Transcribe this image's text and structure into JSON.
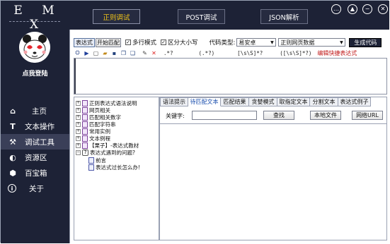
{
  "brand": "E M X",
  "login": "点我登陆",
  "nav": [
    {
      "icon": "home-icon",
      "glyph": "⌂",
      "label": "主页",
      "active": false
    },
    {
      "icon": "text-icon",
      "glyph": "T",
      "label": "文本操作",
      "active": false
    },
    {
      "icon": "wrench-icon",
      "glyph": "⚒",
      "label": "调试工具",
      "active": true
    },
    {
      "icon": "resource-icon",
      "glyph": "◐",
      "label": "资源区",
      "active": false
    },
    {
      "icon": "box-icon",
      "glyph": "⬢",
      "label": "百宝箱",
      "active": false
    },
    {
      "icon": "info-icon",
      "glyph": "i",
      "label": "关于",
      "active": false
    }
  ],
  "top_tabs": [
    {
      "label": "正则调试",
      "active": true
    },
    {
      "label": "POST调试",
      "active": false
    },
    {
      "label": "JSON解析",
      "active": false
    }
  ],
  "window_buttons": {
    "chat": "…",
    "up": "▲",
    "minimize": "−",
    "close": "✕"
  },
  "toolbar": {
    "expression_btn": "表达式",
    "match_btn": "开始匹配",
    "multiline": {
      "label": "多行模式",
      "checked": true
    },
    "case": {
      "label": "区分大小写",
      "checked": true
    },
    "code_type_label": "代码类型:",
    "code_type_value": "易安卓",
    "regex_source_value": "正则网页数据",
    "generate_btn": "生成代码",
    "regex_1": ".*?",
    "regex_2": "(.*?)",
    "regex_3": "[\\s\\S]*?",
    "regex_4": "([\\s\\S]*?)",
    "shortcut_label": "编辑快捷表达式"
  },
  "tree": [
    {
      "type": "folder",
      "label": "正则表达式语法说明",
      "expanded": false
    },
    {
      "type": "folder",
      "label": "网页相关",
      "expanded": false
    },
    {
      "type": "folder",
      "label": "匹配相关数字",
      "expanded": false
    },
    {
      "type": "folder",
      "label": "匹配字符串",
      "expanded": false
    },
    {
      "type": "folder",
      "label": "常用实例",
      "expanded": false
    },
    {
      "type": "folder",
      "label": "文本例程",
      "expanded": false
    },
    {
      "type": "folder",
      "label": "【栗子】-表达式教材",
      "expanded": false
    },
    {
      "type": "help",
      "label": "表达式遇到的问题?",
      "expanded": true
    },
    {
      "type": "child",
      "label": "前言"
    },
    {
      "type": "child",
      "label": "表达式过长怎么办!"
    }
  ],
  "result_tabs": [
    "语法提示",
    "待匹配文本",
    "匹配结果",
    "贪婪模式",
    "取指定文本",
    "分割文本",
    "表达式例子"
  ],
  "active_result_tab": 1,
  "keyword_label": "关键字:",
  "find_btn": "查找",
  "local_file_btn": "本地文件",
  "web_url_btn": "网络URL"
}
